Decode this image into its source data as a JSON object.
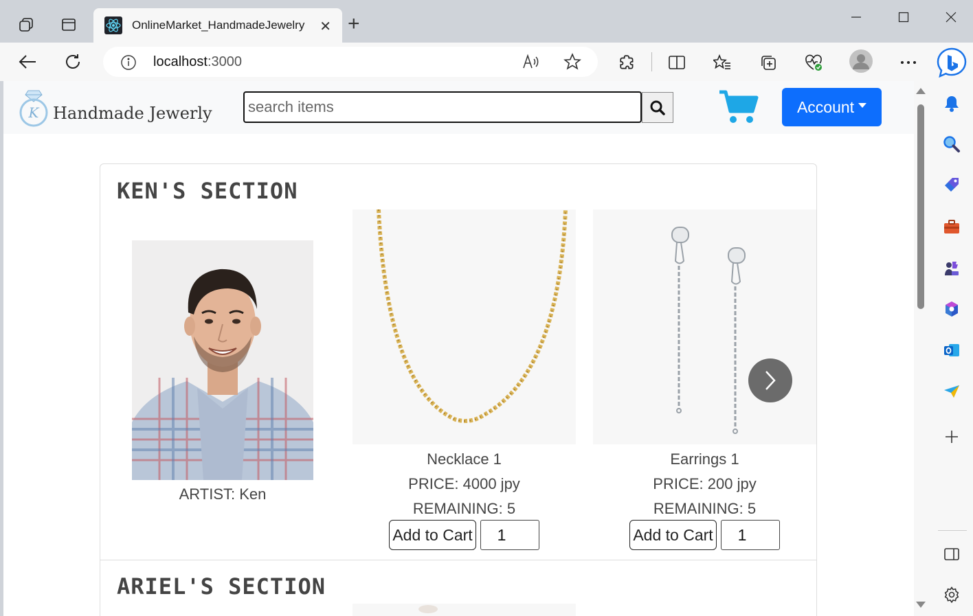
{
  "browser": {
    "tab_title": "OnlineMarket_HandmadeJewelry",
    "url_host": "localhost",
    "url_port": ":3000"
  },
  "site": {
    "brand": "Handmade Jewerly",
    "search_placeholder": "search items",
    "account_label": "Account",
    "cart_color": "#1ea7e6",
    "accent_color": "#0d6efd"
  },
  "sections": [
    {
      "title": "KEN'S SECTION",
      "artist_label": "ARTIST: Ken",
      "products": [
        {
          "name": "Necklace 1",
          "price": "PRICE: 4000 jpy",
          "remaining": "REMAINING: 5",
          "button": "Add to Cart",
          "quantity": "1"
        },
        {
          "name": "Earrings 1",
          "price": "PRICE: 200 jpy",
          "remaining": "REMAINING: 5",
          "button": "Add to Cart",
          "quantity": "1"
        }
      ]
    },
    {
      "title": "ARIEL'S SECTION"
    }
  ]
}
